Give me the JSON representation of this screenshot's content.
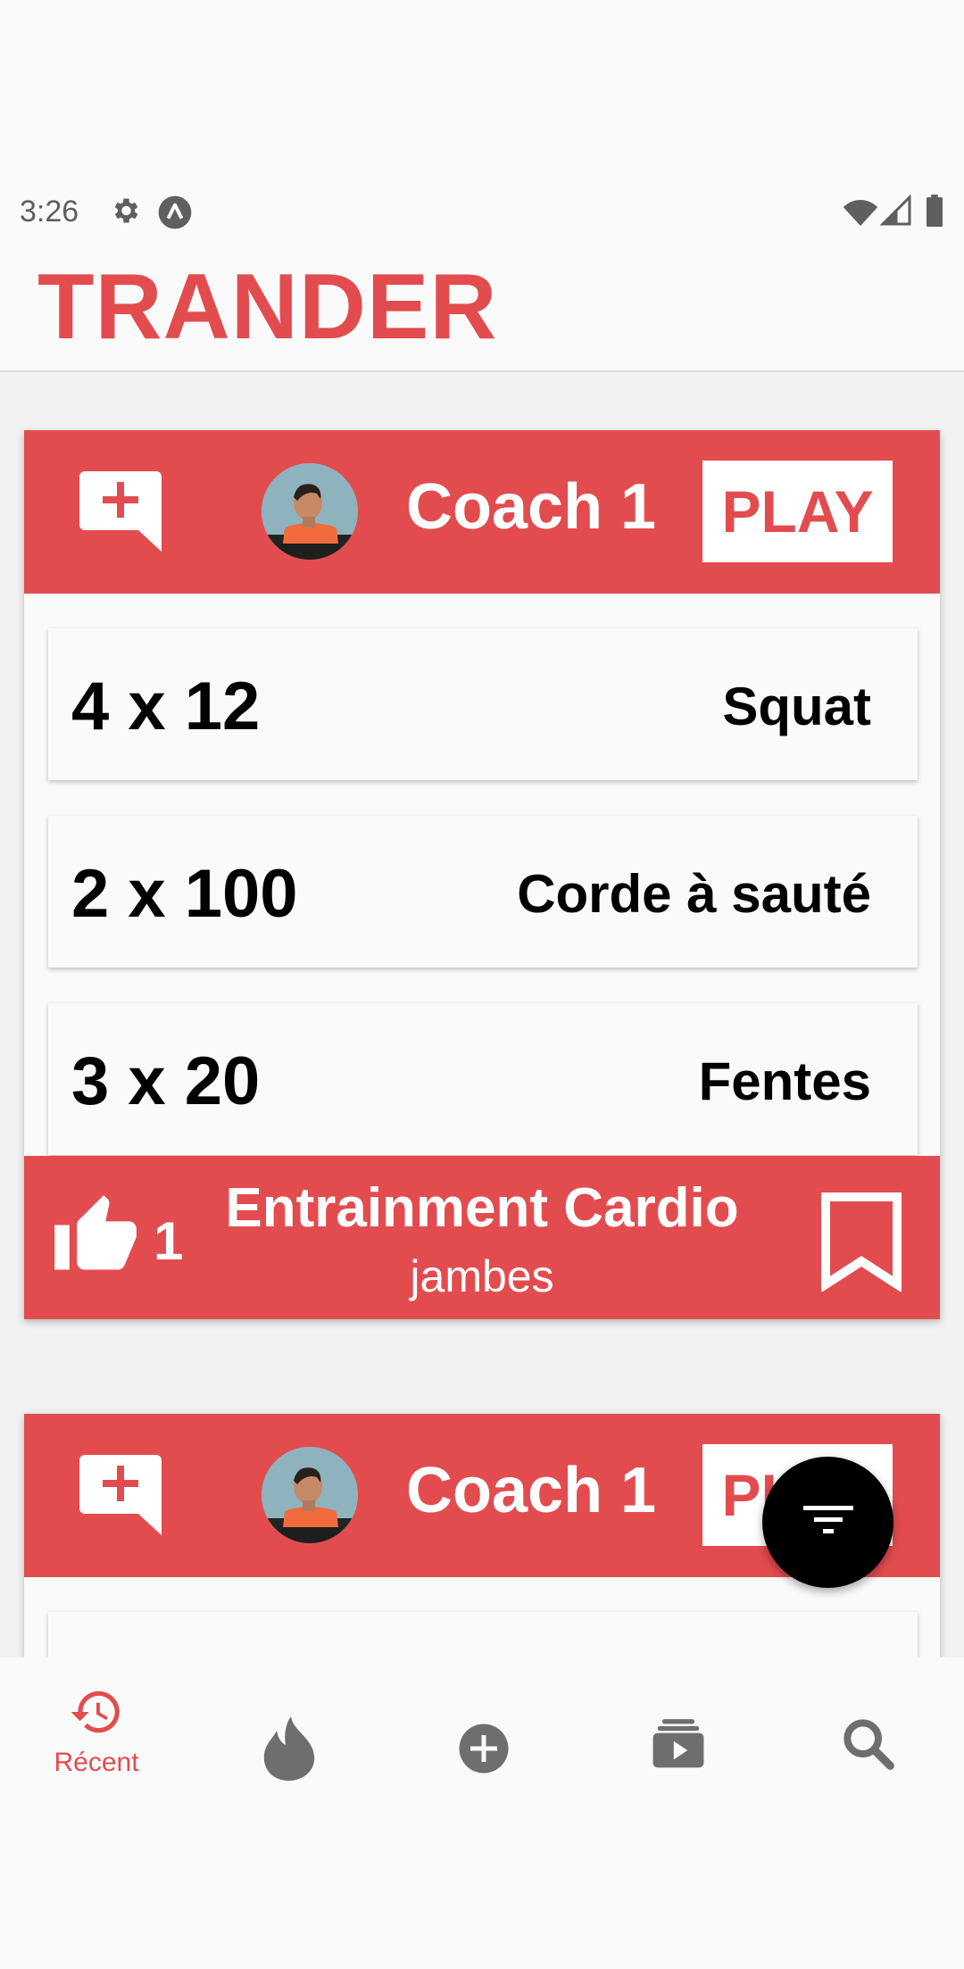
{
  "status_bar": {
    "time": "3:26"
  },
  "app": {
    "title": "TRANDER"
  },
  "colors": {
    "accent": "#e34c4e",
    "background": "#f2f2f2",
    "nav_inactive": "#6e6e6e"
  },
  "cards": [
    {
      "coach": {
        "name": "Coach 1"
      },
      "play_label": "PLAY",
      "exercises": [
        {
          "reps": "4 x 12",
          "name": "Squat"
        },
        {
          "reps": "2 x 100",
          "name": "Corde à sauté"
        },
        {
          "reps": "3 x 20",
          "name": "Fentes"
        }
      ],
      "likes": "1",
      "workout": {
        "title": "Entrainment Cardio",
        "subtitle": "jambes"
      }
    },
    {
      "coach": {
        "name": "Coach 1"
      },
      "play_label": "PLAY"
    }
  ],
  "bottom_nav": {
    "items": [
      {
        "label": "Récent",
        "icon": "history-icon",
        "active": true
      },
      {
        "label": "",
        "icon": "fire-icon",
        "active": false
      },
      {
        "label": "",
        "icon": "add-circle-icon",
        "active": false
      },
      {
        "label": "",
        "icon": "playlist-play-icon",
        "active": false
      },
      {
        "label": "",
        "icon": "search-icon",
        "active": false
      }
    ]
  },
  "fab": {
    "icon": "filter-icon"
  }
}
